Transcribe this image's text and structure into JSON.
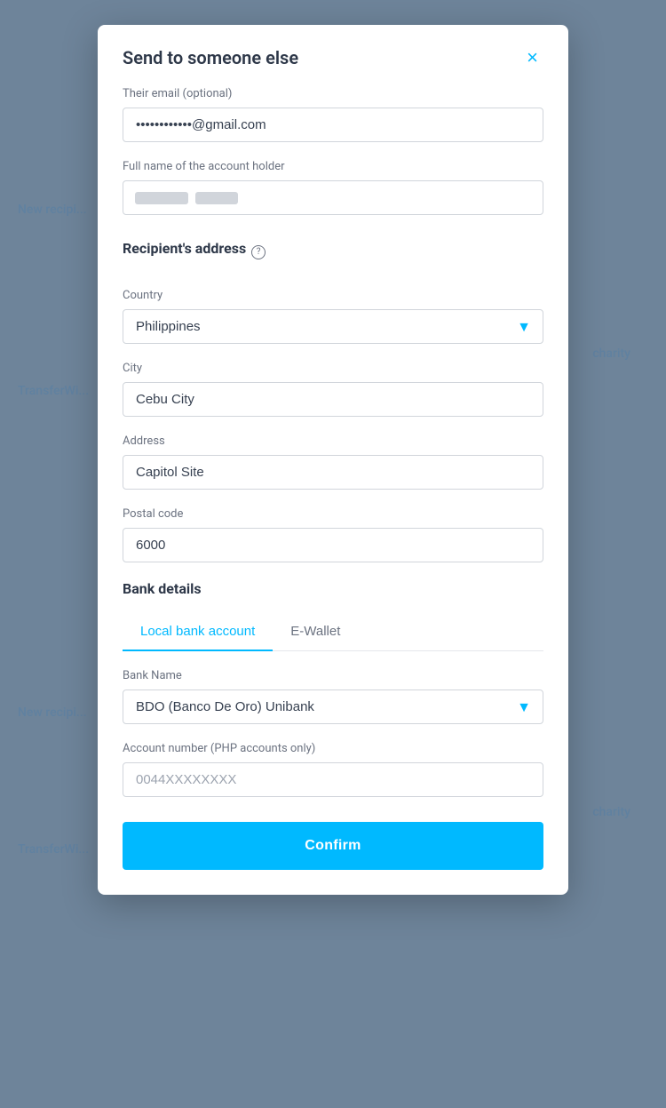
{
  "modal": {
    "title": "Send to someone else",
    "close_label": "×"
  },
  "form": {
    "email_label": "Their email (optional)",
    "email_value_blurred": "••••••••••••",
    "email_suffix": "@gmail.com",
    "fullname_label": "Full name of the account holder",
    "fullname_blurred1": "••••••",
    "fullname_blurred2": "•••••",
    "address_section_label": "Recipient's address",
    "country_label": "Country",
    "country_value": "Philippines",
    "city_label": "City",
    "city_value": "Cebu City",
    "address_label": "Address",
    "address_value": "Capitol Site",
    "postal_label": "Postal code",
    "postal_value": "6000",
    "bank_section_label": "Bank details",
    "tab_local": "Local bank account",
    "tab_ewallet": "E-Wallet",
    "bank_name_label": "Bank Name",
    "bank_name_value": "BDO (Banco De Oro) Unibank",
    "account_number_label": "Account number (PHP accounts only)",
    "account_number_placeholder": "0044XXXXXXXX",
    "confirm_label": "Confirm"
  },
  "background": {
    "text1": "New recipi...",
    "text2": "charity",
    "text3": "TransferWi...",
    "text4": "New recipi...",
    "text5": "charity",
    "text6": "TransferWi..."
  }
}
